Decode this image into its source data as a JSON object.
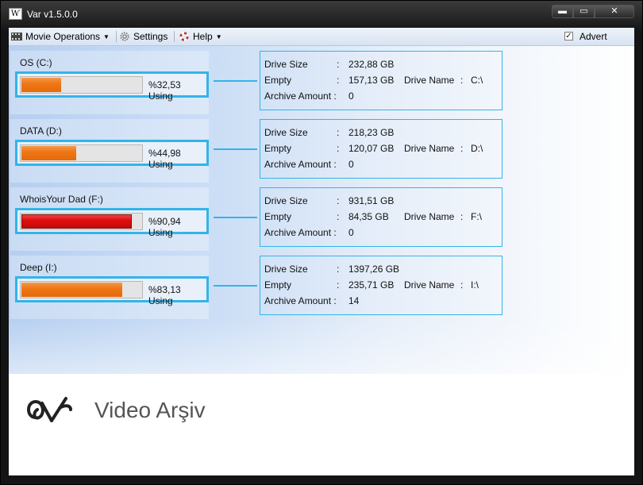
{
  "window": {
    "title": "Var v1.5.0.0",
    "min_glyph": "▬",
    "max_glyph": "▭",
    "close_glyph": "✕"
  },
  "menu": {
    "movie_operations": "Movie Operations",
    "settings": "Settings",
    "help": "Help",
    "chevron": "▼",
    "advert_label": "Advert",
    "advert_checked": "✓"
  },
  "labels": {
    "drive_size": "Drive Size",
    "empty": "Empty",
    "archive_amount": "Archive Amount :",
    "drive_name": "Drive Name",
    "colon": ":"
  },
  "drives": [
    {
      "name": "OS (C:)",
      "usage_text": "%32,53 Using",
      "usage_percent": 32.53,
      "bar_color": "orange",
      "drive_size": "232,88 GB",
      "empty": "157,13 GB",
      "drive_letter": "C:\\",
      "archive_amount": "0"
    },
    {
      "name": "DATA (D:)",
      "usage_text": "%44,98 Using",
      "usage_percent": 44.98,
      "bar_color": "orange",
      "drive_size": "218,23 GB",
      "empty": "120,07 GB",
      "drive_letter": "D:\\",
      "archive_amount": "0"
    },
    {
      "name": "WhoisYour Dad (F:)",
      "usage_text": "%90,94 Using",
      "usage_percent": 90.94,
      "bar_color": "red",
      "drive_size": "931,51 GB",
      "empty": "84,35 GB",
      "drive_letter": "F:\\",
      "archive_amount": "0"
    },
    {
      "name": "Deep (I:)",
      "usage_text": "%83,13 Using",
      "usage_percent": 83.13,
      "bar_color": "orange",
      "drive_size": "1397,26 GB",
      "empty": "235,71 GB",
      "drive_letter": "I:\\",
      "archive_amount": "14"
    }
  ],
  "footer": {
    "brand": "Video Arşiv"
  },
  "colors": {
    "accent": "#33b4e8",
    "bar_orange": "#f07715",
    "bar_red": "#e00e0e"
  }
}
